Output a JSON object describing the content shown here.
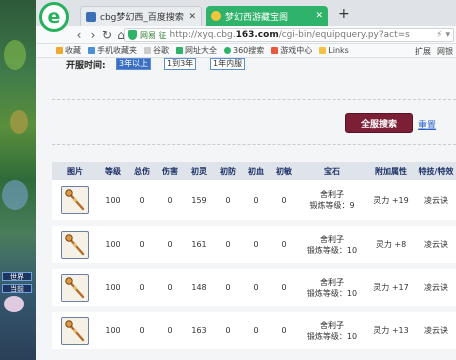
{
  "browser": {
    "tabs": [
      {
        "title": "cbg梦幻西_百度搜索"
      },
      {
        "title": "梦幻西游藏宝阁"
      }
    ],
    "new_tab": "+",
    "nav": {
      "back": "‹",
      "forward": "›",
      "reload": "↻",
      "home": "⌂"
    },
    "address": {
      "site_badge": "网易 征",
      "url_prefix": "http://xyq.cbg.",
      "url_domain": "163.com",
      "url_rest": "/cgi-bin/equipquery.py?act=s"
    },
    "bookmarks": [
      "收藏",
      "手机收藏夹",
      "谷歌",
      "网址大全",
      "360搜索",
      "游戏中心",
      "Links"
    ],
    "bookmarks_right": [
      "扩展",
      "网银"
    ]
  },
  "game": {
    "hud": [
      "世界",
      "当前"
    ]
  },
  "filter": {
    "open_time_label": "开服时间:",
    "options": [
      "3年以上",
      "1到3年",
      "1年内服"
    ]
  },
  "actions": {
    "search_all": "全服搜索",
    "reset": "重置"
  },
  "table": {
    "headers": [
      "图片",
      "等级",
      "总伤",
      "伤害",
      "初灵",
      "初防",
      "初血",
      "初敏",
      "宝石",
      "附加属性",
      "特技/特效"
    ],
    "rows": [
      {
        "level": "100",
        "c1": "0",
        "c2": "0",
        "c3": "159",
        "c4": "0",
        "c5": "0",
        "c6": "0",
        "gem": "舍利子",
        "gem_level": "锻炼等级：9",
        "attr": "灵力 +19",
        "skill": "凌云诀"
      },
      {
        "level": "100",
        "c1": "0",
        "c2": "0",
        "c3": "161",
        "c4": "0",
        "c5": "0",
        "c6": "0",
        "gem": "舍利子",
        "gem_level": "锻炼等级：10",
        "attr": "灵力 +8",
        "skill": "凌云诀"
      },
      {
        "level": "100",
        "c1": "0",
        "c2": "0",
        "c3": "148",
        "c4": "0",
        "c5": "0",
        "c6": "0",
        "gem": "舍利子",
        "gem_level": "锻炼等级：10",
        "attr": "灵力 +17",
        "skill": "凌云诀"
      },
      {
        "level": "100",
        "c1": "0",
        "c2": "0",
        "c3": "163",
        "c4": "0",
        "c5": "0",
        "c6": "0",
        "gem": "舍利子",
        "gem_level": "锻炼等级：10",
        "attr": "灵力 +13",
        "skill": "凌云诀"
      }
    ]
  },
  "colors": {
    "tab_active": "#2fb36a",
    "search_button": "#7d1e37",
    "header_text": "#1b2f66",
    "link": "#2a62c9"
  }
}
